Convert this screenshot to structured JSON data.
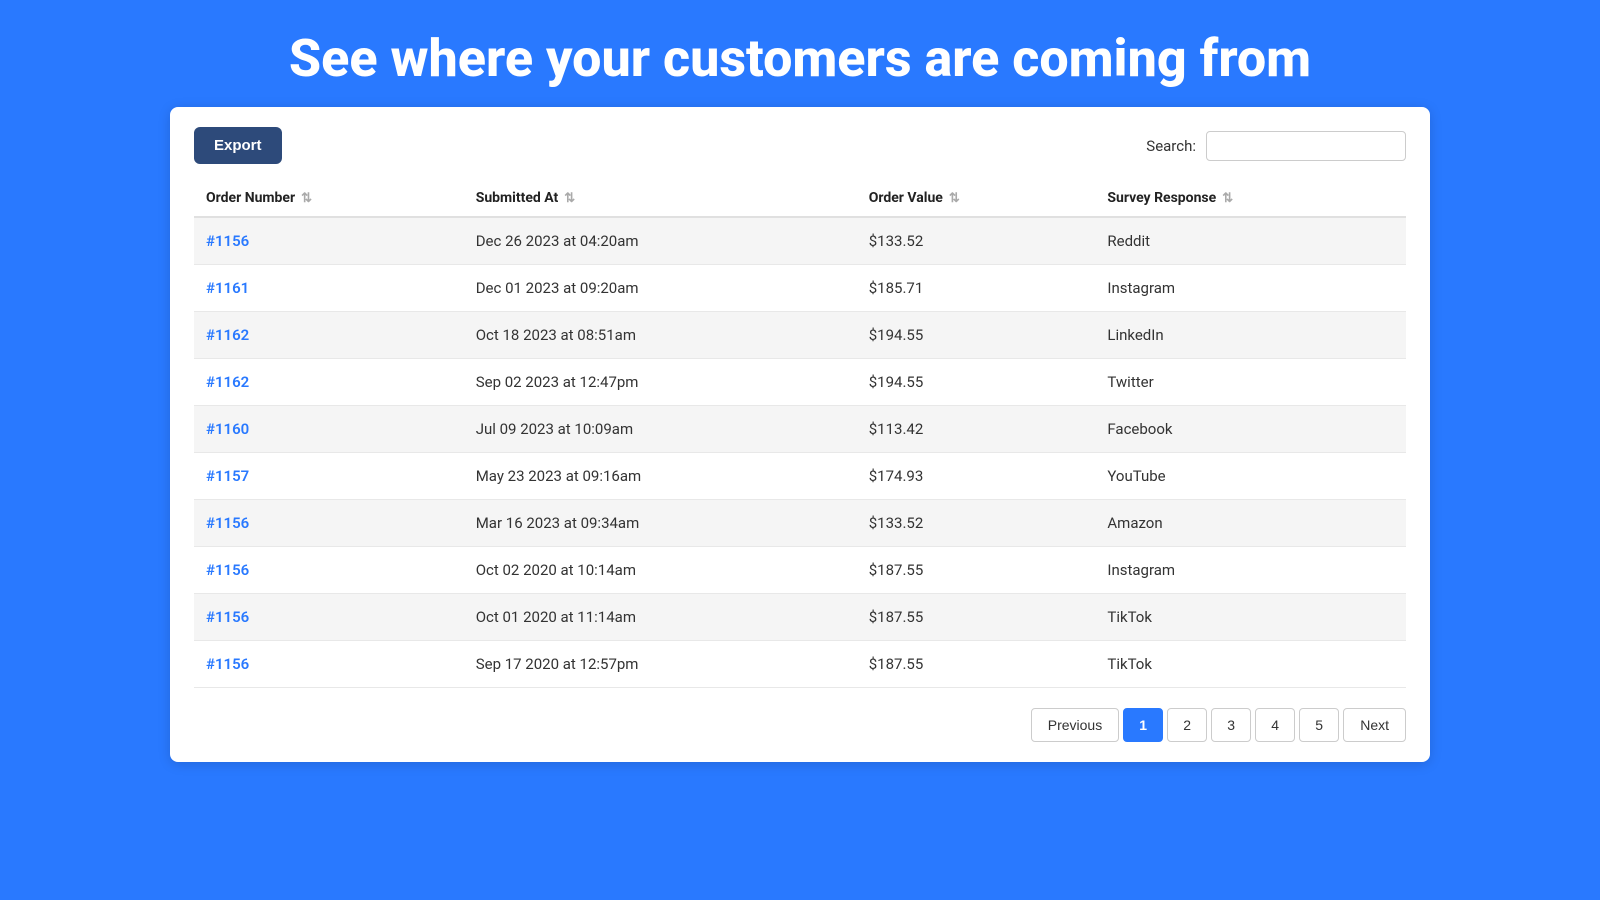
{
  "heading": "See where your customers are coming from",
  "toolbar": {
    "export_label": "Export",
    "search_label": "Search:"
  },
  "table": {
    "columns": [
      {
        "id": "order_number",
        "label": "Order Number"
      },
      {
        "id": "submitted_at",
        "label": "Submitted At"
      },
      {
        "id": "order_value",
        "label": "Order Value"
      },
      {
        "id": "survey_response",
        "label": "Survey Response"
      }
    ],
    "rows": [
      {
        "order": "#1156",
        "submitted": "Dec 26 2023 at 04:20am",
        "value": "$133.52",
        "response": "Reddit"
      },
      {
        "order": "#1161",
        "submitted": "Dec 01 2023 at 09:20am",
        "value": "$185.71",
        "response": "Instagram"
      },
      {
        "order": "#1162",
        "submitted": "Oct 18 2023 at 08:51am",
        "value": "$194.55",
        "response": "LinkedIn"
      },
      {
        "order": "#1162",
        "submitted": "Sep 02 2023 at 12:47pm",
        "value": "$194.55",
        "response": "Twitter"
      },
      {
        "order": "#1160",
        "submitted": "Jul 09 2023 at 10:09am",
        "value": "$113.42",
        "response": "Facebook"
      },
      {
        "order": "#1157",
        "submitted": "May 23 2023 at 09:16am",
        "value": "$174.93",
        "response": "YouTube"
      },
      {
        "order": "#1156",
        "submitted": "Mar 16 2023 at 09:34am",
        "value": "$133.52",
        "response": "Amazon"
      },
      {
        "order": "#1156",
        "submitted": "Oct 02 2020 at 10:14am",
        "value": "$187.55",
        "response": "Instagram"
      },
      {
        "order": "#1156",
        "submitted": "Oct 01 2020 at 11:14am",
        "value": "$187.55",
        "response": "TikTok"
      },
      {
        "order": "#1156",
        "submitted": "Sep 17 2020 at 12:57pm",
        "value": "$187.55",
        "response": "TikTok"
      }
    ]
  },
  "pagination": {
    "previous_label": "Previous",
    "next_label": "Next",
    "pages": [
      "1",
      "2",
      "3",
      "4",
      "5"
    ],
    "active_page": "1"
  }
}
